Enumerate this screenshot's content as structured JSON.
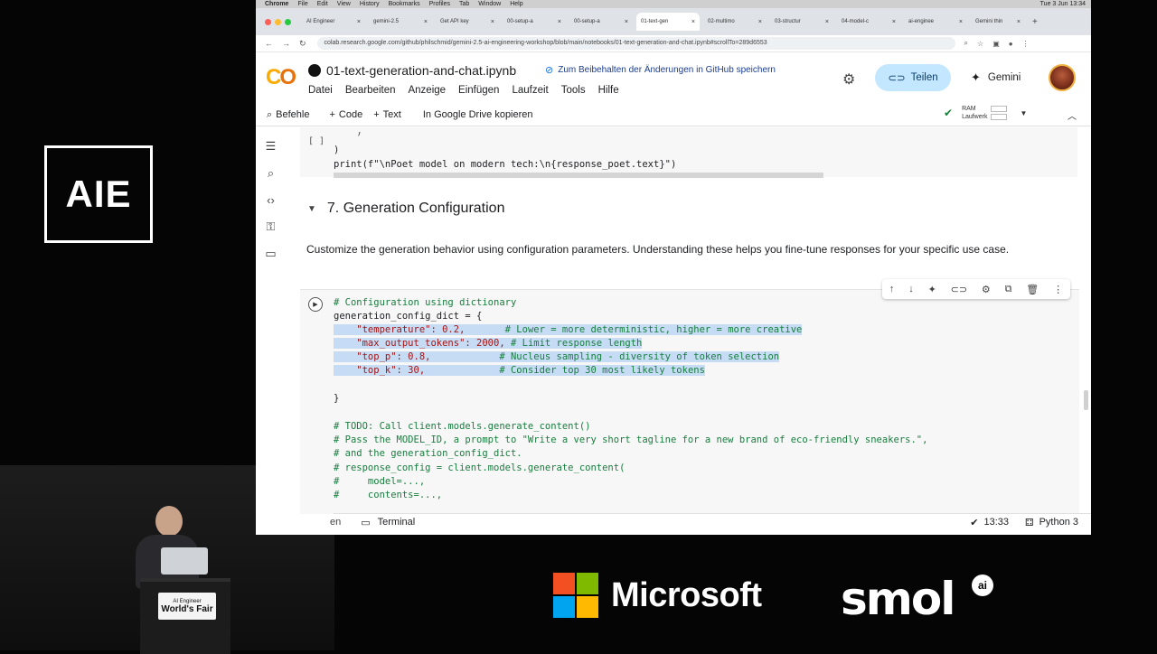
{
  "overlay": {
    "aie_logo": "AIE",
    "podium_line1": "AI Engineer",
    "podium_line2": "World's Fair",
    "microsoft": "Microsoft",
    "smol": "smol",
    "smol_ai": "ai"
  },
  "mac_menu": [
    "Chrome",
    "File",
    "Edit",
    "View",
    "History",
    "Bookmarks",
    "Profiles",
    "Tab",
    "Window",
    "Help"
  ],
  "mac_clock": "Tue 3 Jun 13:34",
  "tabs": [
    {
      "label": "AI Engineer"
    },
    {
      "label": "gemini-2.5"
    },
    {
      "label": "Get API key"
    },
    {
      "label": "00-setup-a"
    },
    {
      "label": "00-setup-a"
    },
    {
      "label": "01-text-gen",
      "active": true
    },
    {
      "label": "02-multimo"
    },
    {
      "label": "03-structur"
    },
    {
      "label": "04-model-c"
    },
    {
      "label": "ai-enginee"
    },
    {
      "label": "Gemini thin"
    }
  ],
  "url": "colab.research.google.com/github/philschmid/gemini-2.5-ai-engineering-workshop/blob/main/notebooks/01-text-generation-and-chat.ipynb#scrollTo=289d6553",
  "colab": {
    "logo_c": "C",
    "logo_o": "O",
    "notebook_title": "01-text-generation-and-chat.ipynb",
    "save_hint": "Zum Beibehalten der Änderungen in GitHub speichern",
    "menu": [
      "Datei",
      "Bearbeiten",
      "Anzeige",
      "Einfügen",
      "Laufzeit",
      "Tools",
      "Hilfe"
    ],
    "share_label": "Teilen",
    "gemini_label": "Gemini",
    "toolbar": {
      "commands": "Befehle",
      "add_code": "Code",
      "add_text": "Text",
      "copy_drive": "In Google Drive kopieren",
      "ram": "RAM",
      "disk": "Laufwerk"
    }
  },
  "prev_cell": {
    "bracket": "[ ]",
    "line1": "    )",
    "line2": ")",
    "line3": "print(f\"\\nPoet model on modern tech:\\n{response_poet.text}\")"
  },
  "section": {
    "heading": "7. Generation Configuration",
    "description": "Customize the generation behavior using configuration parameters. Understanding these helps you fine-tune responses for your specific use case."
  },
  "code_cell": {
    "l1": "# Configuration using dictionary",
    "l2": "generation_config_dict = {",
    "l3a": "    \"temperature\": 0.2,",
    "l3b": "       # Lower = more deterministic, higher = more creative",
    "l4a": "    \"max_output_tokens\": 2000,",
    "l4b": " # Limit response length",
    "l5a": "    \"top_p\": 0.8,",
    "l5b": "            # Nucleus sampling - diversity of token selection",
    "l6a": "    \"top_k\": 30,",
    "l6b": "             # Consider top 30 most likely tokens",
    "l7": "}",
    "l8": "# TODO: Call client.models.generate_content()",
    "l9": "# Pass the MODEL_ID, a prompt to \"Write a very short tagline for a new brand of eco-friendly sneakers.\",",
    "l10": "# and the generation_config_dict.",
    "l11": "# response_config = client.models.generate_content(",
    "l12": "#     model=...,",
    "l13": "#     contents=...,"
  },
  "statusbar": {
    "partial": "en",
    "terminal": "Terminal",
    "time": "13:33",
    "runtime": "Python 3"
  }
}
